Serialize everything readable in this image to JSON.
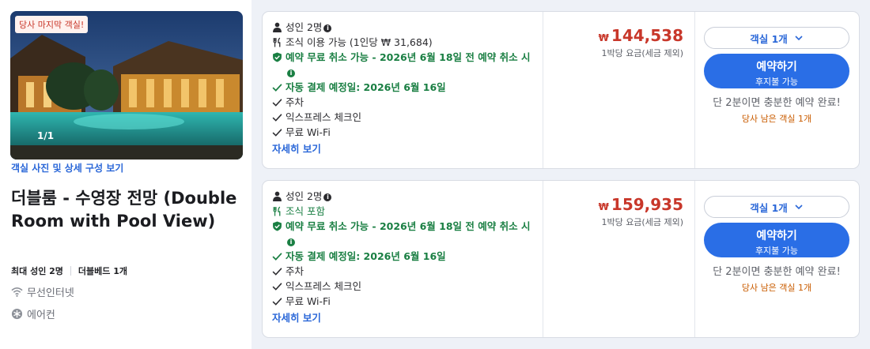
{
  "room": {
    "badge": "당사 마지막 객실!",
    "photo_count": "1/1",
    "photo_link": "객실 사진 및 상세 구성 보기",
    "title": "더블룸 - 수영장 전망 (Double Room with Pool View)",
    "max_guests": "최대 성인 2명",
    "bed": "더블베드 1개",
    "amenities": [
      {
        "icon": "wifi-icon",
        "label": "무선인터넷"
      },
      {
        "icon": "snowflake-icon",
        "label": "에어컨"
      }
    ]
  },
  "offers": [
    {
      "guests": "성인 2명",
      "meal": "조식 이용 가능 (1인당 ₩ 31,684)",
      "meal_included": false,
      "cancel": "예약 무료 취소 가능 - 2026년 6월 18일 전 예약 취소 시",
      "payment": "자동 결제 예정일: 2026년 6월 16일",
      "features": [
        "주차",
        "익스프레스 체크인",
        "무료 Wi-Fi"
      ],
      "details_link": "자세히 보기",
      "currency": "₩",
      "price": "144,538",
      "price_note": "1박당 요금(세금 제외)",
      "room_select": "객실 1개",
      "book_label": "예약하기",
      "book_sub": "후지불 가능",
      "quick_note": "단 2분이면 충분한 예약 완료!",
      "remaining": "당사 남은 객실 1개"
    },
    {
      "guests": "성인 2명",
      "meal": "조식 포함",
      "meal_included": true,
      "cancel": "예약 무료 취소 가능 - 2026년 6월 18일 전 예약 취소 시",
      "payment": "자동 결제 예정일: 2026년 6월 16일",
      "features": [
        "주차",
        "익스프레스 체크인",
        "무료 Wi-Fi"
      ],
      "details_link": "자세히 보기",
      "currency": "₩",
      "price": "159,935",
      "price_note": "1박당 요금(세금 제외)",
      "room_select": "객실 1개",
      "book_label": "예약하기",
      "book_sub": "후지불 가능",
      "quick_note": "단 2분이면 충분한 예약 완료!",
      "remaining": "당사 남은 객실 1개"
    }
  ],
  "colors": {
    "price": "#c8372a",
    "accent": "#2a6ee6",
    "green": "#1a7f43",
    "remaining": "#c95c00"
  }
}
